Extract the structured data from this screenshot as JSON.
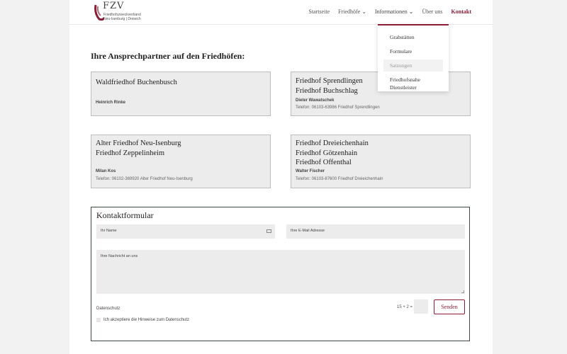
{
  "logo": {
    "title": "FZV",
    "line1": "Friedhofszweckverband",
    "line2": "Neu-Isenburg | Dreieich"
  },
  "nav": {
    "items": [
      {
        "label": "Startseite"
      },
      {
        "label": "Friedhöfe",
        "has_dropdown": true
      },
      {
        "label": "Informationen",
        "has_dropdown": true
      },
      {
        "label": "Über uns"
      },
      {
        "label": "Kontakt"
      }
    ],
    "dropdown": [
      {
        "label": "Grabstätten"
      },
      {
        "label": "Formulare"
      },
      {
        "label": "Satzungen"
      },
      {
        "label": "Friedhofsnahe Dienstleister"
      }
    ]
  },
  "section_title": "Ihre Ansprechpartner auf den Friedhöfen:",
  "cards": [
    {
      "titles": [
        "Waldfriedhof Buchenbusch"
      ],
      "name": "Heinrich Rinke",
      "phone": ""
    },
    {
      "titles": [
        "Friedhof Sprendlingen",
        "Friedhof Buchschlag"
      ],
      "name": "Dieter Wawatschek",
      "phone": "Telefon: 06103-63986 Friedhof Sprendlingen"
    },
    {
      "titles": [
        "Alter Friedhof Neu-Isenburg",
        "Friedhof Zeppelinheim"
      ],
      "name": "Milan Kos",
      "phone": "Telefon: 06102-369920 Alter Friedhof Neu-Isenburg"
    },
    {
      "titles": [
        "Friedhof Dreieichenhain",
        "Friedhof Götzenhain",
        "Friedhof Offenthal"
      ],
      "name": "Walter Fischer",
      "phone": "Telefon: 06103-87600 Friedhof Dreieichenhain"
    }
  ],
  "form": {
    "title": "Kontaktformular",
    "name_placeholder": "Ihr Name",
    "email_placeholder": "Ihre E-Mail Adresse",
    "message_placeholder": "Ihre Nachricht an uns",
    "privacy_label": "Datenschutz",
    "consent_label": "Ich akzeptiere die Hinweise zum Datenschutz",
    "captcha_question": "15 + 2 =",
    "send_label": "Senden"
  },
  "colors": {
    "brand": "#8a1c36",
    "card_bg": "#ececec",
    "form_border": "#3d4a40"
  }
}
